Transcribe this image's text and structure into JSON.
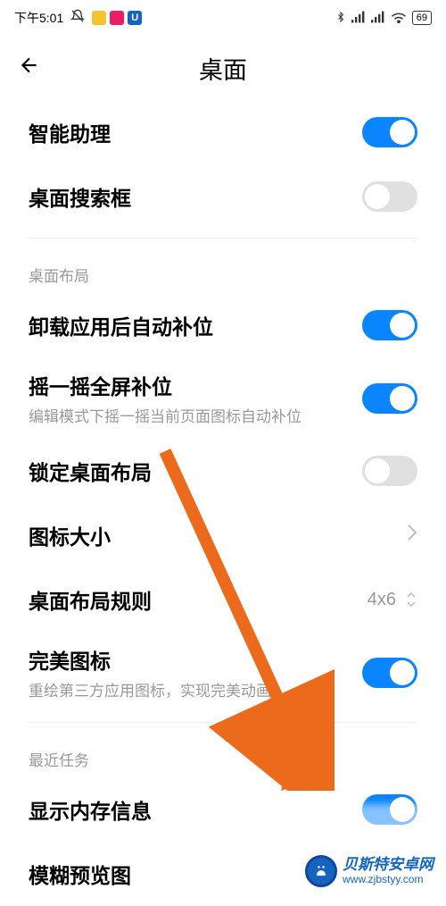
{
  "status": {
    "time": "下午5:01",
    "battery": "69",
    "app_u": "U"
  },
  "header": {
    "title": "桌面"
  },
  "settings": {
    "smart_assistant": {
      "label": "智能助理",
      "on": true
    },
    "search_box": {
      "label": "桌面搜索框",
      "on": false
    }
  },
  "layout_section": {
    "label": "桌面布局",
    "auto_fill": {
      "label": "卸载应用后自动补位",
      "on": true
    },
    "shake_fill": {
      "label": "摇一摇全屏补位",
      "sub": "编辑模式下摇一摇当前页面图标自动补位",
      "on": true
    },
    "lock_layout": {
      "label": "锁定桌面布局",
      "on": false
    },
    "icon_size": {
      "label": "图标大小"
    },
    "layout_rule": {
      "label": "桌面布局规则",
      "value": "4x6"
    },
    "perfect_icon": {
      "label": "完美图标",
      "sub": "重绘第三方应用图标，实现完美动画",
      "on": true
    }
  },
  "recent_section": {
    "label": "最近任务",
    "show_memory": {
      "label": "显示内存信息",
      "on": true
    },
    "blur_preview": {
      "label": "模糊预览图"
    }
  },
  "watermark": {
    "title": "贝斯特安卓网",
    "url": "www.zjbstyy.com"
  },
  "colors": {
    "accent": "#0a84ff",
    "arrow": "#ec6a1c"
  }
}
